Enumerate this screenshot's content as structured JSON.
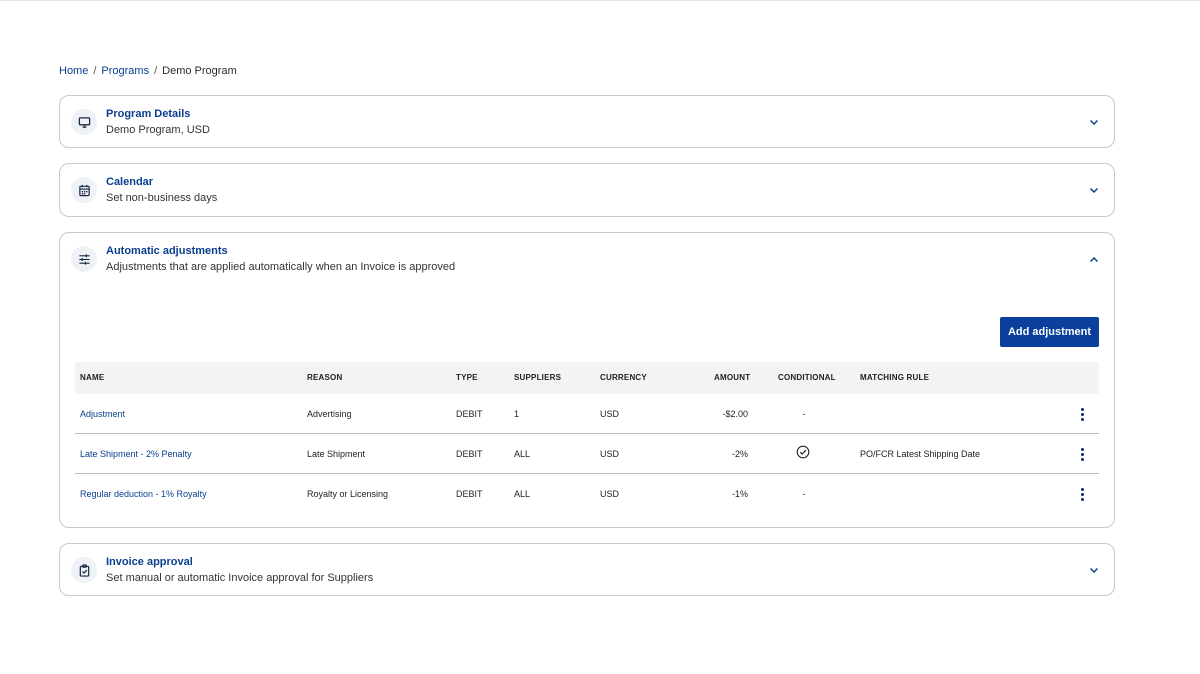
{
  "breadcrumb": {
    "items": [
      "Home",
      "Programs",
      "Demo Program"
    ],
    "separator": "/"
  },
  "sections": {
    "details": {
      "title": "Program Details",
      "subtitle": "Demo Program, USD",
      "icon": "monitor-icon",
      "expanded": false
    },
    "calendar": {
      "title": "Calendar",
      "subtitle": "Set non-business days",
      "icon": "calendar-icon",
      "expanded": false
    },
    "auto": {
      "title": "Automatic adjustments",
      "subtitle": "Adjustments that are applied automatically when an Invoice is approved",
      "icon": "sliders-icon",
      "expanded": true,
      "add_button": "Add adjustment"
    },
    "invoice": {
      "title": "Invoice approval",
      "subtitle": "Set manual or automatic Invoice approval for Suppliers",
      "icon": "clipboard-check-icon",
      "expanded": false
    }
  },
  "table": {
    "headers": {
      "name": "NAME",
      "reason": "REASON",
      "type": "TYPE",
      "suppliers": "SUPPLIERS",
      "currency": "CURRENCY",
      "amount": "AMOUNT",
      "conditional": "CONDITIONAL",
      "matching_rule": "MATCHING RULE"
    },
    "rows": [
      {
        "name": "Adjustment",
        "reason": "Advertising",
        "type": "DEBIT",
        "suppliers": "1",
        "currency": "USD",
        "amount": "-$2.00",
        "conditional": "-",
        "matching_rule": ""
      },
      {
        "name": "Late Shipment - 2% Penalty",
        "reason": "Late Shipment",
        "type": "DEBIT",
        "suppliers": "ALL",
        "currency": "USD",
        "amount": "-2%",
        "conditional": "check",
        "matching_rule": "PO/FCR Latest Shipping Date"
      },
      {
        "name": "Regular deduction - 1% Royalty",
        "reason": "Royalty or Licensing",
        "type": "DEBIT",
        "suppliers": "ALL",
        "currency": "USD",
        "amount": "-1%",
        "conditional": "-",
        "matching_rule": ""
      }
    ]
  },
  "colors": {
    "accent": "#0a3f8f",
    "button": "#0a3f9c",
    "header_bg": "#f3f3f3",
    "border": "#c9c9c9"
  }
}
